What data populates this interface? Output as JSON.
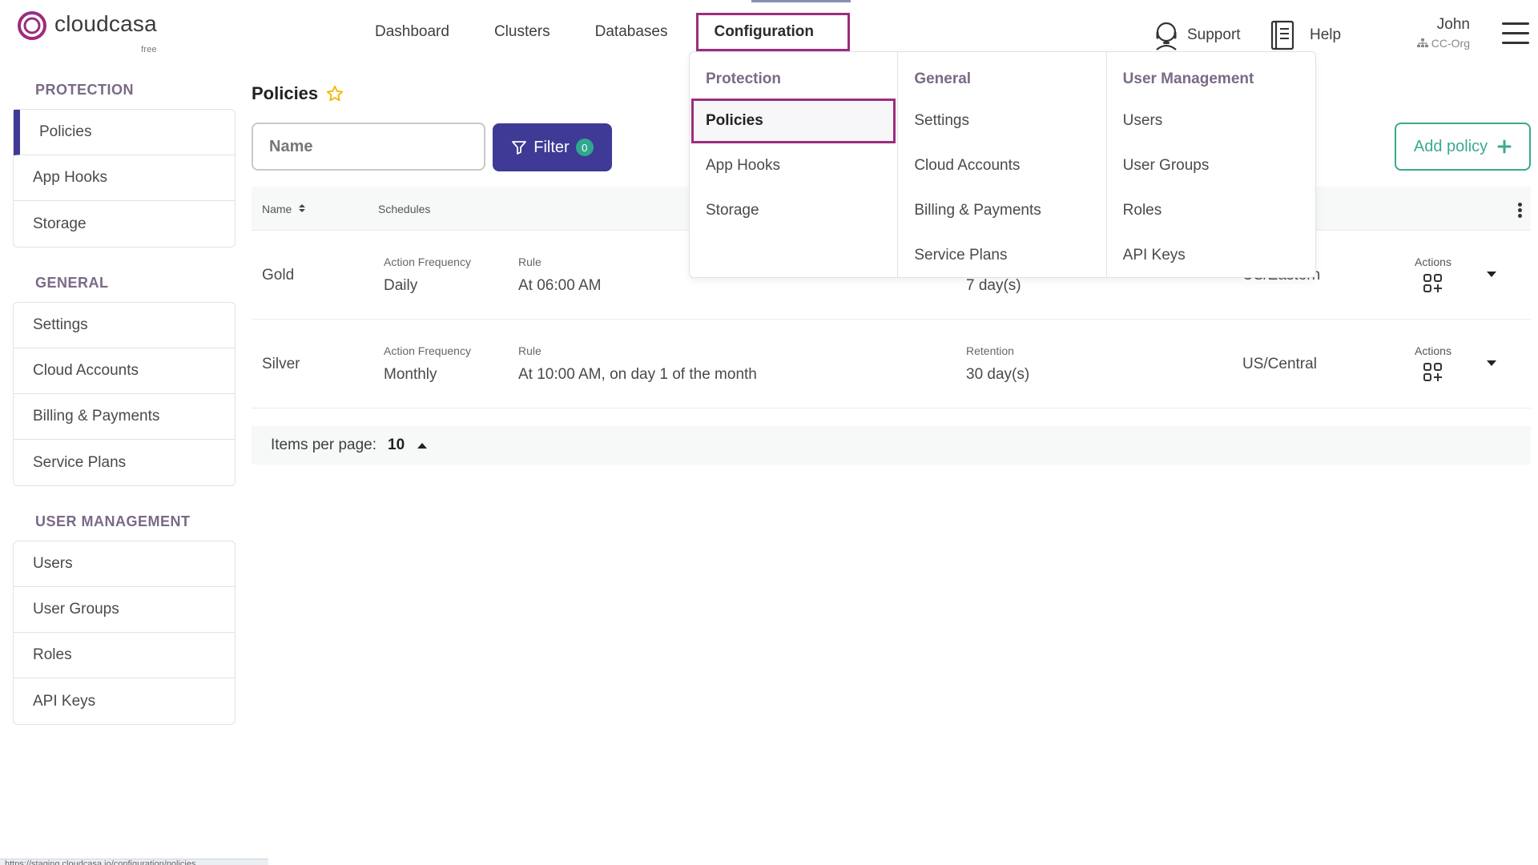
{
  "brand": {
    "name": "cloudcasa",
    "tier": "free",
    "color": "#9b2d7f"
  },
  "nav": {
    "items": [
      {
        "label": "Dashboard"
      },
      {
        "label": "Clusters"
      },
      {
        "label": "Databases"
      },
      {
        "label": "Configuration"
      }
    ],
    "active": "Configuration"
  },
  "header": {
    "support_label": "Support",
    "help_label": "Help",
    "user_name": "John",
    "org_name": "CC-Org"
  },
  "sidebar": {
    "sections": [
      {
        "title": "PROTECTION",
        "items": [
          "Policies",
          "App Hooks",
          "Storage"
        ]
      },
      {
        "title": "GENERAL",
        "items": [
          "Settings",
          "Cloud Accounts",
          "Billing & Payments",
          "Service Plans"
        ]
      },
      {
        "title": "USER MANAGEMENT",
        "items": [
          "Users",
          "User Groups",
          "Roles",
          "API Keys"
        ]
      }
    ],
    "active": "Policies"
  },
  "main": {
    "title": "Policies",
    "search_placeholder": "Name",
    "filter_label": "Filter",
    "filter_count": "0",
    "add_label": "Add policy",
    "columns": {
      "name": "Name",
      "schedules": "Schedules"
    },
    "rows": [
      {
        "name": "Gold",
        "freq_label": "Action Frequency",
        "freq": "Daily",
        "rule_label": "Rule",
        "rule": "At 06:00 AM",
        "retention_label": "",
        "retention": "7 day(s)",
        "timezone": "US/Eastern",
        "actions_label": "Actions"
      },
      {
        "name": "Silver",
        "freq_label": "Action Frequency",
        "freq": "Monthly",
        "rule_label": "Rule",
        "rule": "At 10:00 AM, on day 1 of the month",
        "retention_label": "Retention",
        "retention": "30 day(s)",
        "timezone": "US/Central",
        "actions_label": "Actions"
      }
    ],
    "pager_label": "Items per page:",
    "pager_value": "10"
  },
  "mega_menu": {
    "columns": [
      {
        "title": "Protection",
        "items": [
          "Policies",
          "App Hooks",
          "Storage"
        ]
      },
      {
        "title": "General",
        "items": [
          "Settings",
          "Cloud Accounts",
          "Billing & Payments",
          "Service Plans"
        ]
      },
      {
        "title": "User Management",
        "items": [
          "Users",
          "User Groups",
          "Roles",
          "API Keys"
        ]
      }
    ],
    "active": "Policies"
  },
  "status_bar": "https://staging.cloudcasa.io/configuration/policies",
  "colors": {
    "primary": "#3f3a96",
    "accent": "#3aa98f",
    "highlight": "#9b2d7f",
    "star": "#f2b705"
  }
}
